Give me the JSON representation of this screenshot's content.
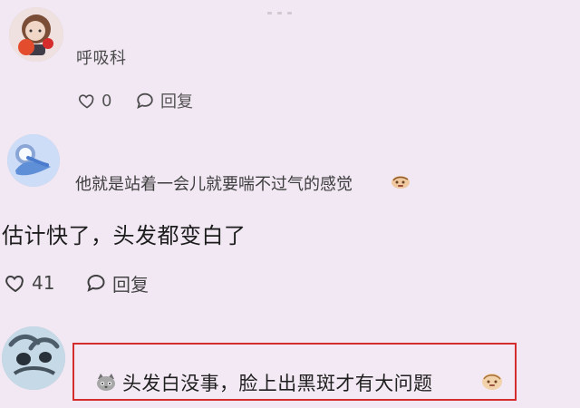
{
  "comments": [
    {
      "username": "呼吸科",
      "like_count": "0",
      "reply_label": "回复"
    },
    {
      "text_line": "他就是站着一会儿就要喘不过气的感觉",
      "body": "估计快了，头发都变白了",
      "like_count": "41",
      "reply_label": "回复"
    },
    {
      "highlighted_text": "头发白没事，脸上出黑斑才有大问题"
    }
  ],
  "icons": {
    "heart": "heart-icon",
    "reply": "reply-icon",
    "emoji": "emoji-icon",
    "face": "cat-face-icon"
  },
  "colors": {
    "background": "#f2e8f4",
    "highlight_border": "#d32d2d",
    "text_primary": "#1d1d1d",
    "text_secondary": "#555555"
  }
}
